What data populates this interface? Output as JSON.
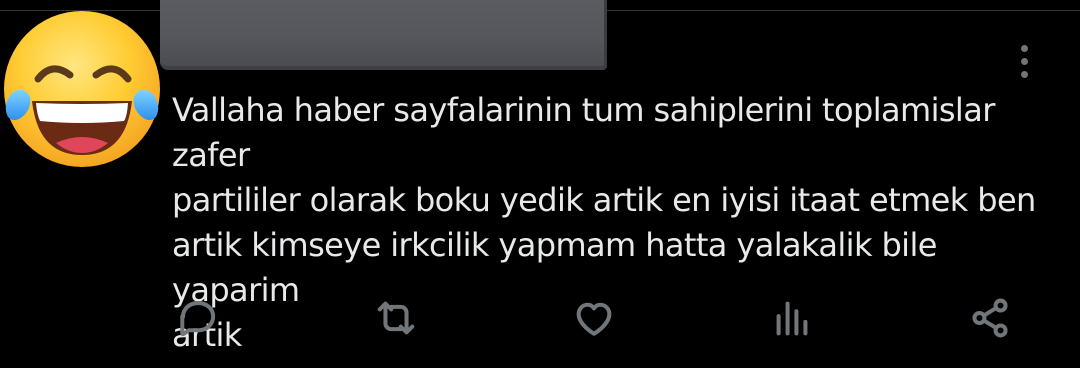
{
  "post": {
    "text": "Vallaha haber sayfalarinin tum sahiplerini toplamislar zafer\npartililer olarak boku yedik artik en iyisi itaat etmek ben\nartik kimseye irkcilik yapmam hatta yalakalik bile yaparim\nartik"
  },
  "avatar": {
    "icon": "face-with-tears-of-joy-emoji"
  },
  "icons": {
    "more": "more-vertical-icon",
    "reply": "reply-icon",
    "repost": "repost-icon",
    "like": "heart-icon",
    "views": "views-icon",
    "share": "share-icon"
  },
  "colors": {
    "background": "#000000",
    "text": "#e7e9ea",
    "icon": "#71767b",
    "redacted": "#55565b"
  }
}
